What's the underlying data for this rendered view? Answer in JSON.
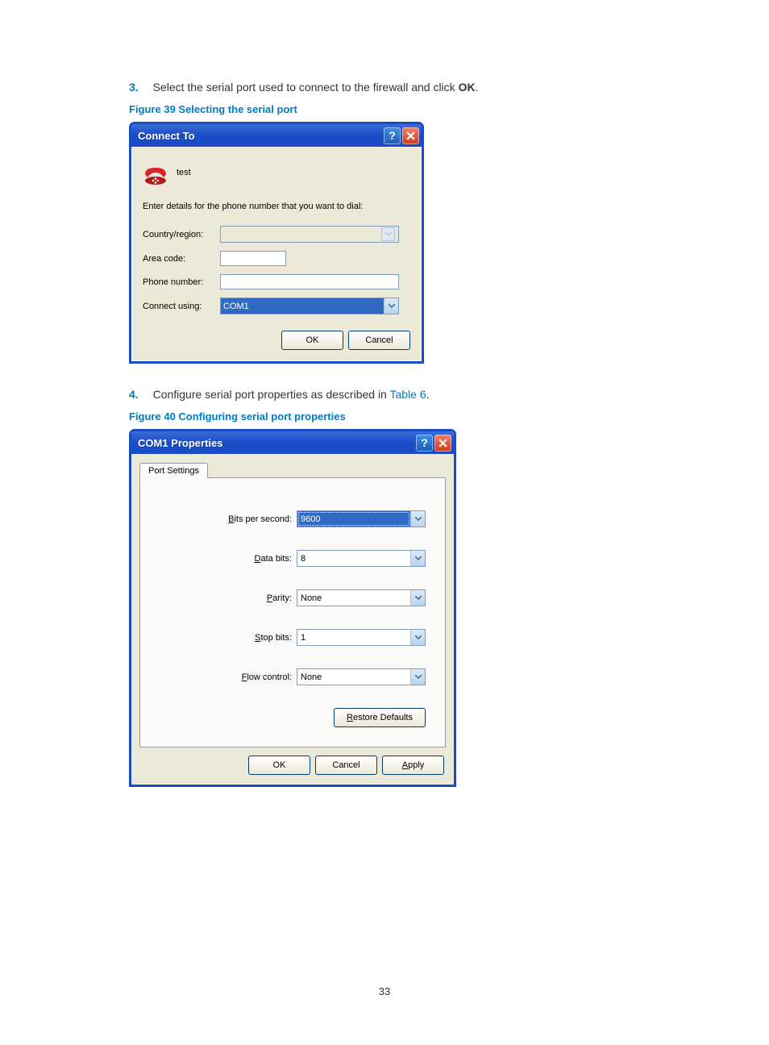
{
  "step3": {
    "num": "3.",
    "text_before": "Select the serial port used to connect to the firewall and click ",
    "text_bold": "OK",
    "text_after": "."
  },
  "fig39_caption": "Figure 39 Selecting the serial port",
  "dialog1": {
    "title": "Connect To",
    "connection_name": "test",
    "instruction": "Enter details for the phone number that you want to dial:",
    "labels": {
      "country": "Country/region:",
      "area": "Area code:",
      "phone": "Phone number:",
      "connect": "Connect using:"
    },
    "connect_using_value": "COM1",
    "ok": "OK",
    "cancel": "Cancel"
  },
  "step4": {
    "num": "4.",
    "text_before": "Configure serial port properties as described in ",
    "link": "Table 6",
    "text_after": "."
  },
  "fig40_caption": "Figure 40 Configuring serial port properties",
  "dialog2": {
    "title": "COM1 Properties",
    "tab": "Port Settings",
    "rows": {
      "bits_label": "Bits per second:",
      "bits_value": "9600",
      "data_label": "Data bits:",
      "data_value": "8",
      "parity_label": "Parity:",
      "parity_value": "None",
      "stop_label": "Stop bits:",
      "stop_value": "1",
      "flow_label": "Flow control:",
      "flow_value": "None"
    },
    "restore": "Restore Defaults",
    "ok": "OK",
    "cancel": "Cancel",
    "apply": "Apply"
  },
  "page_number": "33"
}
